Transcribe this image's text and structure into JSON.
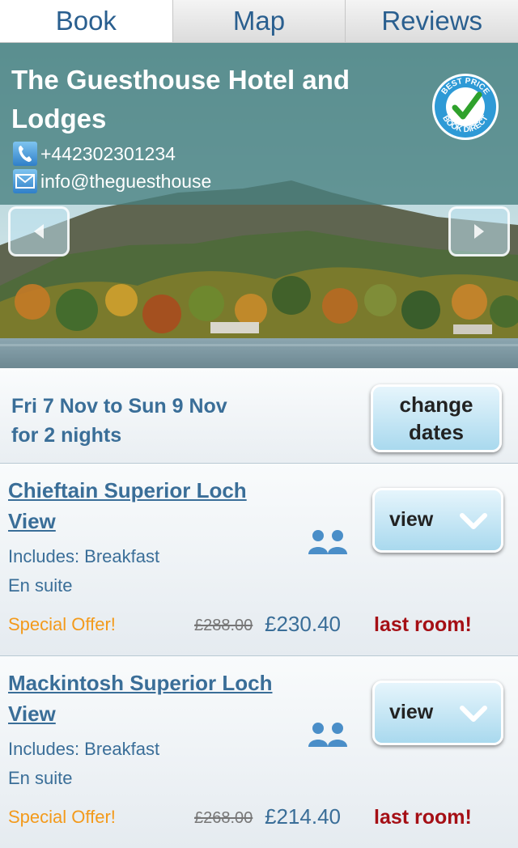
{
  "tabs": [
    {
      "label": "Book",
      "active": true
    },
    {
      "label": "Map",
      "active": false
    },
    {
      "label": "Reviews",
      "active": false
    }
  ],
  "hotel": {
    "name": "The Guesthouse Hotel and Lodges",
    "phone": "+442302301234",
    "email": "info@theguesthouse",
    "badge_text": [
      "BEST PRICE",
      "BOOK DIRECT"
    ],
    "phone_icon": "phone-icon",
    "email_icon": "envelope-icon"
  },
  "dates": {
    "line1": "Fri 7 Nov to Sun 9 Nov",
    "line2": "for 2 nights",
    "change_label_1": "change",
    "change_label_2": "dates"
  },
  "rooms": [
    {
      "name": "Chieftain Superior Loch View",
      "includes": "Includes: Breakfast",
      "suite": "En suite",
      "offer": "Special Offer!",
      "old_price": "£288.00",
      "price": "£230.40",
      "availability": "last room!",
      "view_label": "view"
    },
    {
      "name": "Mackintosh Superior Loch View",
      "includes": "Includes: Breakfast",
      "suite": "En suite",
      "offer": "Special Offer!",
      "old_price": "£268.00",
      "price": "£214.40",
      "availability": "last room!",
      "view_label": "view"
    }
  ],
  "colors": {
    "accent_text": "#3a6e98",
    "offer": "#f39a1b",
    "last_room": "#a50f15",
    "header_overlay": "#488080"
  }
}
